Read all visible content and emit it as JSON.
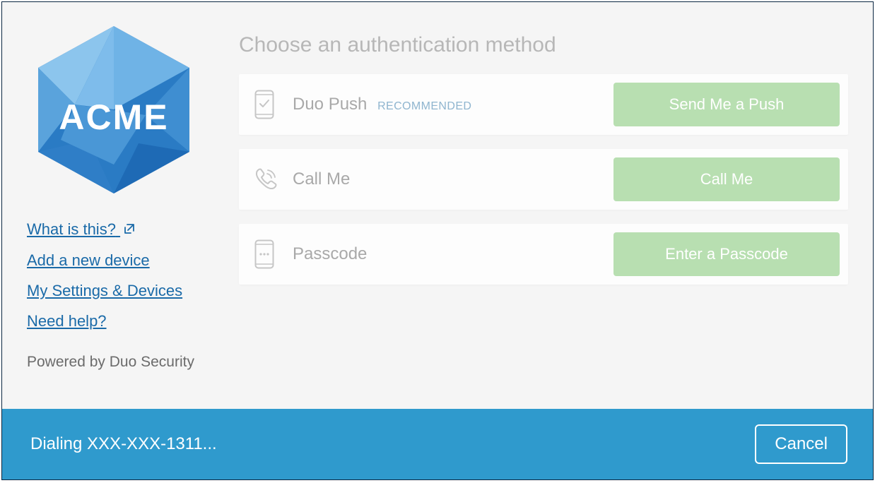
{
  "logo": {
    "brand": "ACME"
  },
  "sidebar": {
    "links": {
      "what_is_this": "What is this?",
      "add_device": "Add a new device",
      "settings_devices": "My Settings & Devices",
      "need_help": "Need help?"
    },
    "powered_by": "Powered by Duo Security"
  },
  "main": {
    "heading": "Choose an authentication method",
    "methods": {
      "push": {
        "label": "Duo Push",
        "recommended": "RECOMMENDED",
        "button": "Send Me a Push"
      },
      "call": {
        "label": "Call Me",
        "button": "Call Me"
      },
      "passcode": {
        "label": "Passcode",
        "button": "Enter a Passcode"
      }
    }
  },
  "status": {
    "text": "Dialing XXX-XXX-1311...",
    "cancel": "Cancel"
  },
  "colors": {
    "link": "#1a6aa8",
    "button_green": "#b8dfb1",
    "status_blue": "#2f9acd"
  }
}
